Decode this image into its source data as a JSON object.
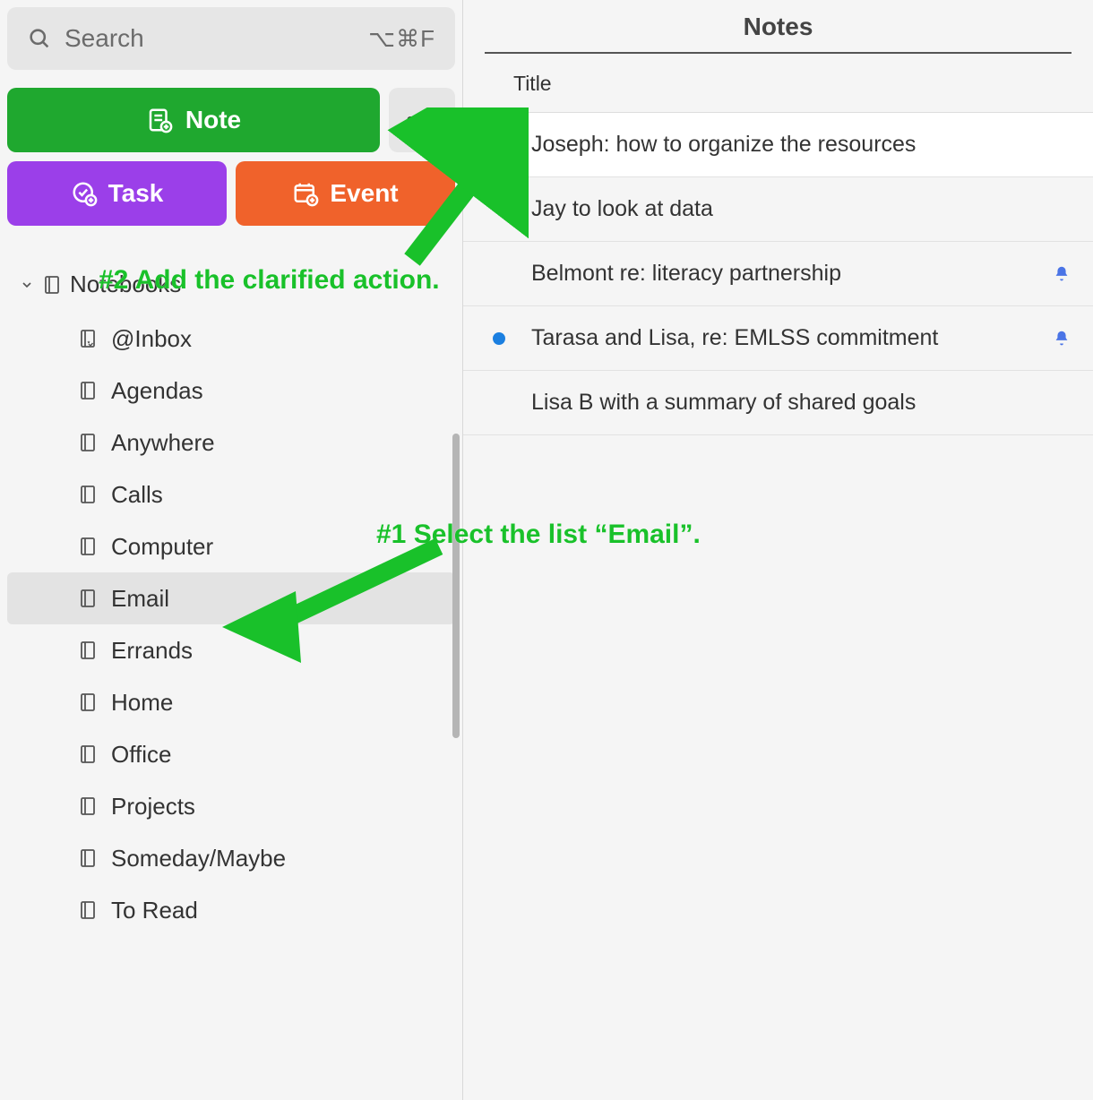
{
  "search": {
    "placeholder": "Search",
    "shortcut": "⌥⌘F"
  },
  "buttons": {
    "note": "Note",
    "task": "Task",
    "event": "Event",
    "more": "•••"
  },
  "sidebar": {
    "notebooks_label": "Notebooks",
    "items": [
      {
        "label": "@Inbox",
        "selected": false,
        "starred": true
      },
      {
        "label": "Agendas",
        "selected": false
      },
      {
        "label": "Anywhere",
        "selected": false
      },
      {
        "label": "Calls",
        "selected": false
      },
      {
        "label": "Computer",
        "selected": false
      },
      {
        "label": "Email",
        "selected": true
      },
      {
        "label": "Errands",
        "selected": false
      },
      {
        "label": "Home",
        "selected": false
      },
      {
        "label": "Office",
        "selected": false
      },
      {
        "label": "Projects",
        "selected": false
      },
      {
        "label": "Someday/Maybe",
        "selected": false
      },
      {
        "label": "To Read",
        "selected": false
      }
    ]
  },
  "main": {
    "header": "Notes",
    "column_title": "Title",
    "notes": [
      {
        "title": "Joseph: how to organize the resources",
        "unread": false,
        "reminder": false,
        "selected": true
      },
      {
        "title": "Jay to look at data",
        "unread": false,
        "reminder": false
      },
      {
        "title": "Belmont re: literacy partnership",
        "unread": false,
        "reminder": true
      },
      {
        "title": "Tarasa and Lisa, re: EMLSS commitment",
        "unread": true,
        "reminder": true
      },
      {
        "title": "Lisa B with a summary of shared goals",
        "unread": false,
        "reminder": false
      }
    ]
  },
  "annotations": {
    "step1": "#1 Select the list “Email”.",
    "step2": "#2 Add the clarified action."
  }
}
